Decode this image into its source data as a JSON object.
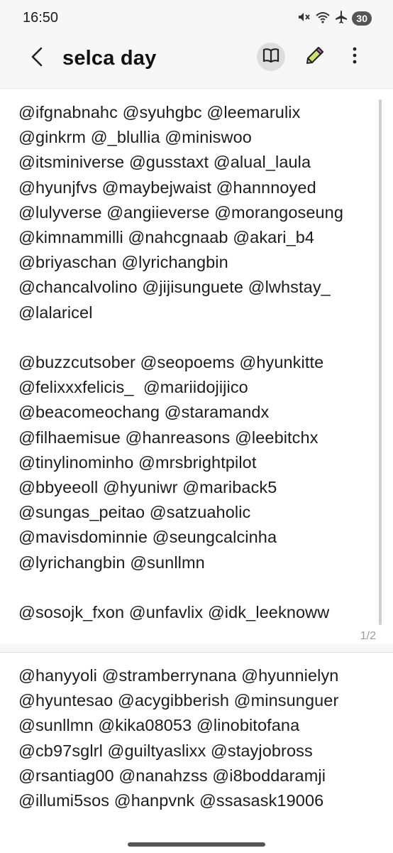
{
  "status_bar": {
    "time": "16:50",
    "battery": "30"
  },
  "app_bar": {
    "title": "selca day"
  },
  "pages": [
    {
      "text": "@ifgnabnahc @syuhgbc @leemarulix\n@ginkrm @_blullia @miniswoo\n@itsminiverse @gusstaxt @alual_laula\n@hyunjfvs @maybejwaist @hannnoyed\n@lulyverse @angiieverse @morangoseung\n@kimnammilli @nahcgnaab @akari_b4\n@briyaschan @lyrichangbin\n@chancalvolino @jijisunguete @lwhstay_\n@lalaricel\n\n@buzzcutsober @seopoems @hyunkitte\n@felixxxfelicis_  @mariidojijico\n@beacomeochang @staramandx\n@filhaemisue @hanreasons @leebitchx\n@tinylinominho @mrsbrightpilot\n@bbyeeoll @hyuniwr @mariback5\n@sungas_peitao @satzuaholic\n@mavisdominnie @seungcalcinha\n@lyrichangbin @sunllmn\n\n@sosojk_fxon @unfavlix @idk_leeknoww",
      "page_number": "1/2"
    },
    {
      "text": "@hanyyoli @stramberrynana @hyunnielyn\n@hyuntesao @acygibberish @minsunguer\n@sunllmn @kika08053 @linobitofana\n@cb97sglrl @guiltyaslixx @stayjobross\n@rsantiag00 @nanahzss @i8boddaramji\n@illumi5sos @hanpvnk @ssasask19006"
    }
  ],
  "icons": {
    "back": "back-arrow-icon",
    "reader": "book-icon",
    "pen": "pen-icon",
    "more": "more-vertical-icon"
  }
}
